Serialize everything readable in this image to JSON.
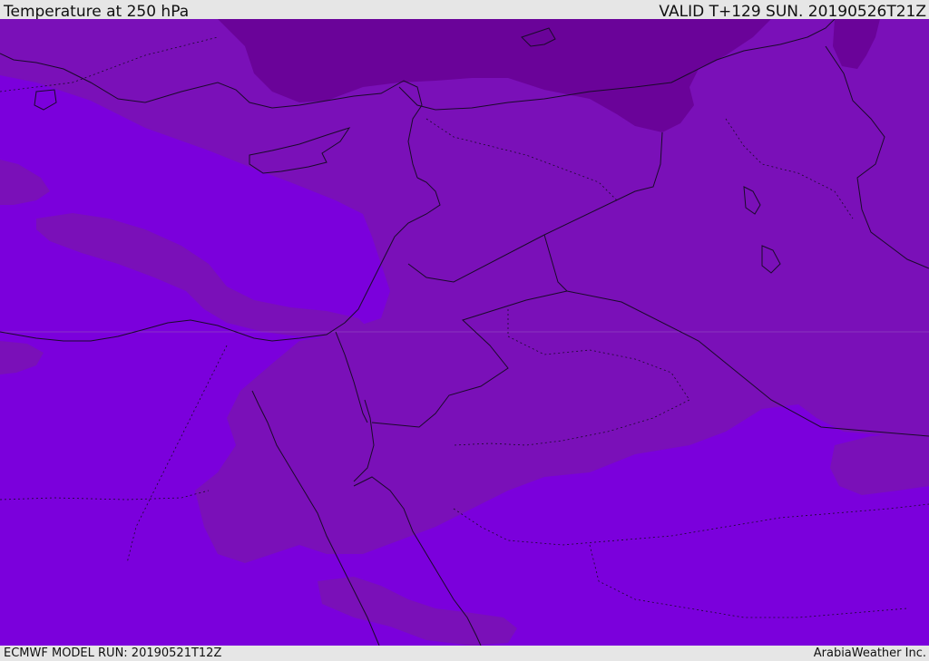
{
  "header": {
    "title": "Temperature at 250 hPa",
    "valid": "VALID T+129 SUN. 20190526T21Z"
  },
  "footer": {
    "model_run": "ECMWF MODEL RUN: 20190521T12Z",
    "credit": "ArabiaWeather Inc."
  },
  "map": {
    "colors": {
      "coldest": "#6a0399",
      "cool": "#7a10b8",
      "mild": "#7b00dc",
      "borders": "#1a0a2a"
    }
  }
}
